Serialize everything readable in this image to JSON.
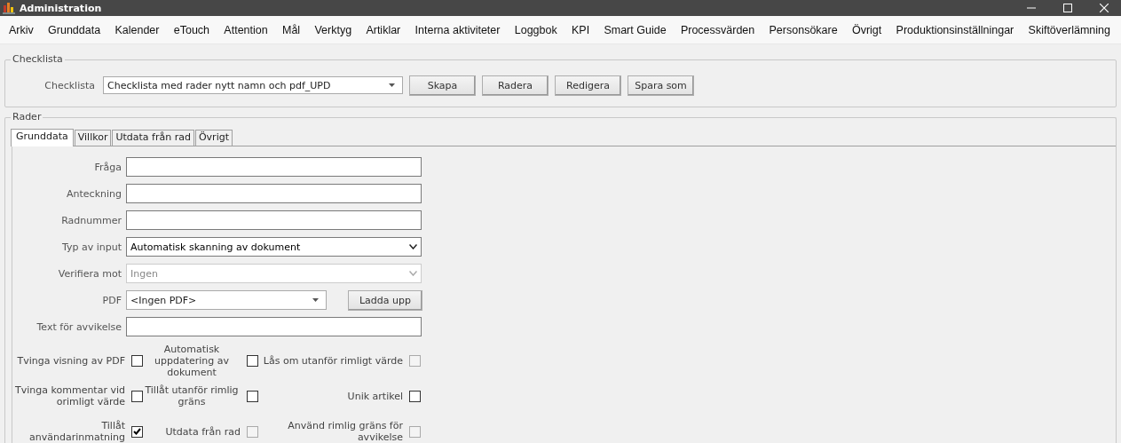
{
  "window": {
    "title": "Administration"
  },
  "menu": [
    "Arkiv",
    "Grunddata",
    "Kalender",
    "eTouch",
    "Attention",
    "Mål",
    "Verktyg",
    "Artiklar",
    "Interna aktiviteter",
    "Loggbok",
    "KPI",
    "Smart Guide",
    "Processvärden",
    "Personsökare",
    "Övrigt",
    "Produktionsinställningar",
    "Skiftöverlämning"
  ],
  "checklist_group": {
    "title": "Checklista",
    "label": "Checklista",
    "value": "Checklista med rader nytt namn och pdf_UPD",
    "buttons": [
      "Skapa",
      "Radera",
      "Redigera",
      "Spara som"
    ]
  },
  "rows_group": {
    "title": "Rader",
    "tabs": [
      {
        "label": "Grunddata",
        "selected": true
      },
      {
        "label": "Villkor",
        "selected": false
      },
      {
        "label": "Utdata från rad",
        "selected": false
      },
      {
        "label": "Övrigt",
        "selected": false
      }
    ],
    "fields": [
      {
        "kind": "text",
        "label": "Fråga"
      },
      {
        "kind": "text",
        "label": "Anteckning"
      },
      {
        "kind": "text",
        "label": "Radnummer"
      },
      {
        "kind": "select",
        "label": "Typ av input",
        "value": "Automatisk skanning av dokument",
        "disabled": false
      },
      {
        "kind": "select",
        "label": "Verifiera mot",
        "value": "Ingen",
        "disabled": true
      },
      {
        "kind": "combo",
        "label": "PDF",
        "value": "<Ingen PDF>",
        "button": "Ladda upp"
      },
      {
        "kind": "text",
        "label": "Text för avvikelse"
      }
    ],
    "checkboxes": [
      {
        "label": "Tvinga visning av PDF",
        "checked": false,
        "disabled": false
      },
      {
        "label": "Automatisk uppdatering av dokument",
        "checked": false,
        "disabled": false
      },
      {
        "label": "Lås om utanför rimligt värde",
        "checked": false,
        "disabled": true
      },
      {
        "label": "Tvinga kommentar vid orimligt värde",
        "checked": false,
        "disabled": false
      },
      {
        "label": "Tillåt utanför rimlig gräns",
        "checked": false,
        "disabled": false
      },
      {
        "label": "Unik artikel",
        "checked": false,
        "disabled": false
      },
      {
        "label": "Tillåt användarinmatning",
        "checked": true,
        "disabled": false
      },
      {
        "label": "Utdata från rad",
        "checked": false,
        "disabled": true
      },
      {
        "label": "Använd rimlig gräns för avvikelse",
        "checked": false,
        "disabled": true
      }
    ]
  }
}
